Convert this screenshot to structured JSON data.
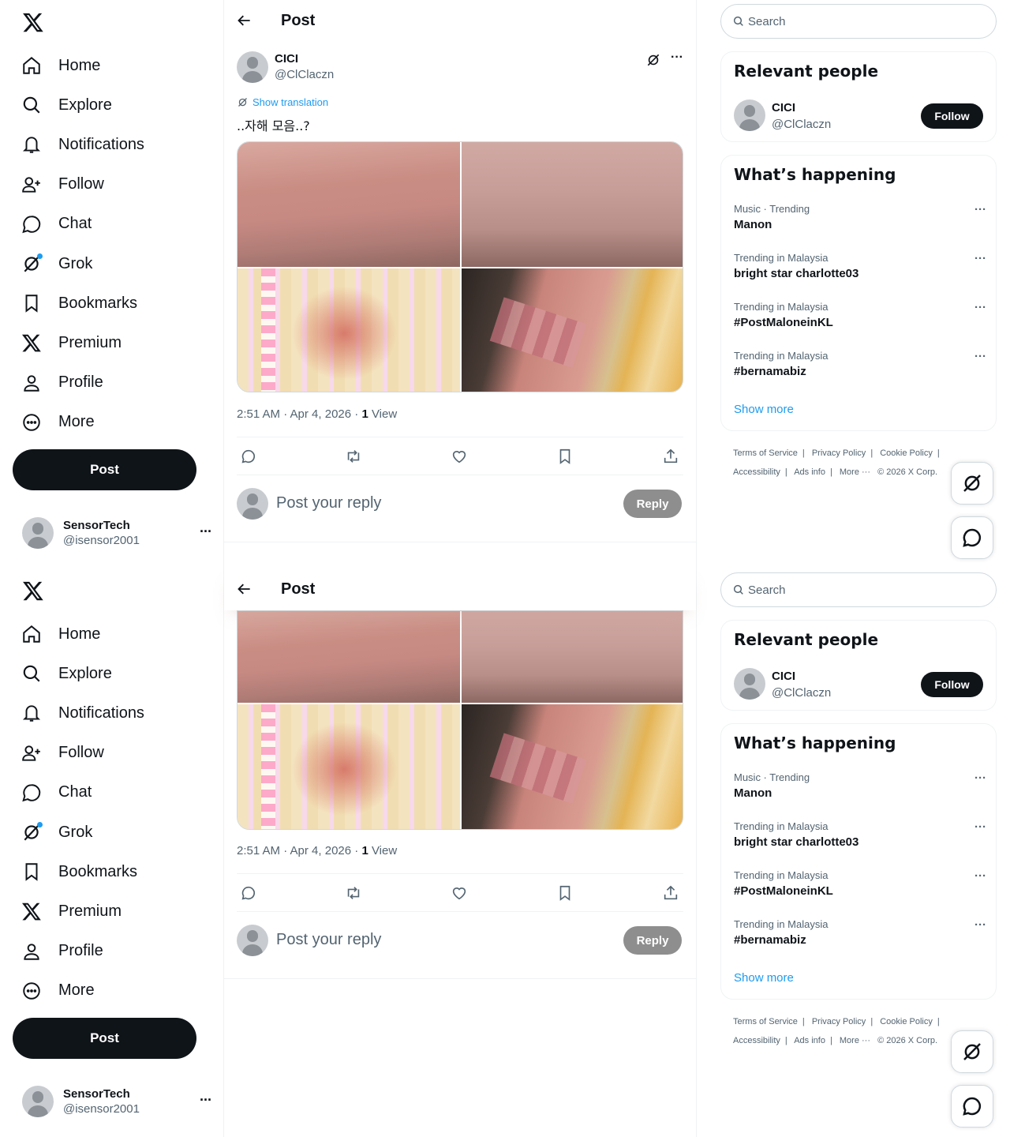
{
  "nav": {
    "items": [
      {
        "label": "Home",
        "icon": "home-icon"
      },
      {
        "label": "Explore",
        "icon": "search-icon"
      },
      {
        "label": "Notifications",
        "icon": "bell-icon"
      },
      {
        "label": "Follow",
        "icon": "add-person-icon"
      },
      {
        "label": "Chat",
        "icon": "chat-bubble-icon"
      },
      {
        "label": "Grok",
        "icon": "grok-icon"
      },
      {
        "label": "Bookmarks",
        "icon": "bookmark-icon"
      },
      {
        "label": "Premium",
        "icon": "x-logo-icon"
      },
      {
        "label": "Profile",
        "icon": "person-icon"
      },
      {
        "label": "More",
        "icon": "more-circle-icon"
      }
    ],
    "post_label": "Post"
  },
  "account": {
    "name": "SensorTech",
    "handle": "@isensor2001"
  },
  "header": {
    "title": "Post"
  },
  "tweet": {
    "author_name": "CICI",
    "author_handle": "@ClClaczn",
    "show_translation": "Show translation",
    "text": "..자해 모음..?",
    "time": "2:51 AM · Apr 4, 2026 · ",
    "views_count": "1",
    "views_label": " View"
  },
  "reply": {
    "placeholder": "Post your reply",
    "button": "Reply"
  },
  "search": {
    "placeholder": "Search"
  },
  "relevant": {
    "title": "Relevant people",
    "name": "CICI",
    "handle": "@ClClaczn",
    "follow": "Follow"
  },
  "happening": {
    "title": "What’s happening",
    "trends": [
      {
        "context": "Music · Trending",
        "topic": "Manon"
      },
      {
        "context": "Trending in Malaysia",
        "topic": "bright star charlotte03"
      },
      {
        "context": "Trending in Malaysia",
        "topic": "#PostMaloneinKL"
      },
      {
        "context": "Trending in Malaysia",
        "topic": "#bernamabiz"
      }
    ],
    "show_more": "Show more"
  },
  "footer": {
    "links": [
      "Terms of Service",
      "|",
      "Privacy Policy",
      "|",
      "Cookie Policy",
      "|",
      "Accessibility",
      "|",
      "Ads info",
      "|",
      "More ···",
      "© 2026 X Corp."
    ]
  },
  "colors": {
    "accent": "#1d9bf0",
    "text": "#0f1419",
    "muted": "#536471",
    "button_dark": "#0f1419"
  }
}
